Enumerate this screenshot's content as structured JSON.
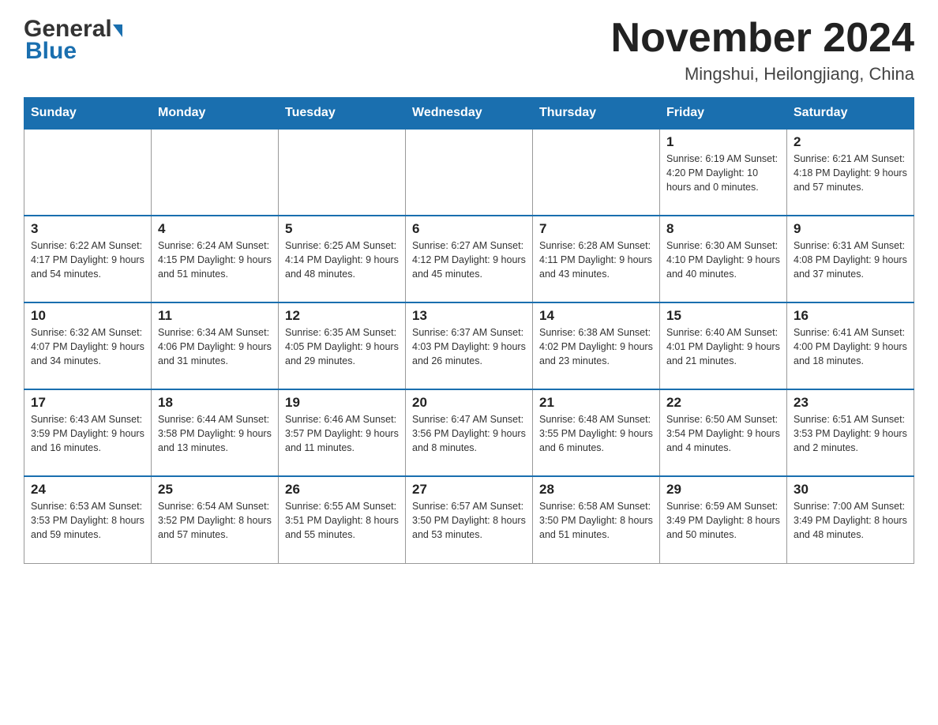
{
  "logo": {
    "general": "General",
    "blue": "Blue"
  },
  "title": "November 2024",
  "subtitle": "Mingshui, Heilongjiang, China",
  "days_of_week": [
    "Sunday",
    "Monday",
    "Tuesday",
    "Wednesday",
    "Thursday",
    "Friday",
    "Saturday"
  ],
  "weeks": [
    [
      {
        "day": "",
        "info": ""
      },
      {
        "day": "",
        "info": ""
      },
      {
        "day": "",
        "info": ""
      },
      {
        "day": "",
        "info": ""
      },
      {
        "day": "",
        "info": ""
      },
      {
        "day": "1",
        "info": "Sunrise: 6:19 AM\nSunset: 4:20 PM\nDaylight: 10 hours\nand 0 minutes."
      },
      {
        "day": "2",
        "info": "Sunrise: 6:21 AM\nSunset: 4:18 PM\nDaylight: 9 hours\nand 57 minutes."
      }
    ],
    [
      {
        "day": "3",
        "info": "Sunrise: 6:22 AM\nSunset: 4:17 PM\nDaylight: 9 hours\nand 54 minutes."
      },
      {
        "day": "4",
        "info": "Sunrise: 6:24 AM\nSunset: 4:15 PM\nDaylight: 9 hours\nand 51 minutes."
      },
      {
        "day": "5",
        "info": "Sunrise: 6:25 AM\nSunset: 4:14 PM\nDaylight: 9 hours\nand 48 minutes."
      },
      {
        "day": "6",
        "info": "Sunrise: 6:27 AM\nSunset: 4:12 PM\nDaylight: 9 hours\nand 45 minutes."
      },
      {
        "day": "7",
        "info": "Sunrise: 6:28 AM\nSunset: 4:11 PM\nDaylight: 9 hours\nand 43 minutes."
      },
      {
        "day": "8",
        "info": "Sunrise: 6:30 AM\nSunset: 4:10 PM\nDaylight: 9 hours\nand 40 minutes."
      },
      {
        "day": "9",
        "info": "Sunrise: 6:31 AM\nSunset: 4:08 PM\nDaylight: 9 hours\nand 37 minutes."
      }
    ],
    [
      {
        "day": "10",
        "info": "Sunrise: 6:32 AM\nSunset: 4:07 PM\nDaylight: 9 hours\nand 34 minutes."
      },
      {
        "day": "11",
        "info": "Sunrise: 6:34 AM\nSunset: 4:06 PM\nDaylight: 9 hours\nand 31 minutes."
      },
      {
        "day": "12",
        "info": "Sunrise: 6:35 AM\nSunset: 4:05 PM\nDaylight: 9 hours\nand 29 minutes."
      },
      {
        "day": "13",
        "info": "Sunrise: 6:37 AM\nSunset: 4:03 PM\nDaylight: 9 hours\nand 26 minutes."
      },
      {
        "day": "14",
        "info": "Sunrise: 6:38 AM\nSunset: 4:02 PM\nDaylight: 9 hours\nand 23 minutes."
      },
      {
        "day": "15",
        "info": "Sunrise: 6:40 AM\nSunset: 4:01 PM\nDaylight: 9 hours\nand 21 minutes."
      },
      {
        "day": "16",
        "info": "Sunrise: 6:41 AM\nSunset: 4:00 PM\nDaylight: 9 hours\nand 18 minutes."
      }
    ],
    [
      {
        "day": "17",
        "info": "Sunrise: 6:43 AM\nSunset: 3:59 PM\nDaylight: 9 hours\nand 16 minutes."
      },
      {
        "day": "18",
        "info": "Sunrise: 6:44 AM\nSunset: 3:58 PM\nDaylight: 9 hours\nand 13 minutes."
      },
      {
        "day": "19",
        "info": "Sunrise: 6:46 AM\nSunset: 3:57 PM\nDaylight: 9 hours\nand 11 minutes."
      },
      {
        "day": "20",
        "info": "Sunrise: 6:47 AM\nSunset: 3:56 PM\nDaylight: 9 hours\nand 8 minutes."
      },
      {
        "day": "21",
        "info": "Sunrise: 6:48 AM\nSunset: 3:55 PM\nDaylight: 9 hours\nand 6 minutes."
      },
      {
        "day": "22",
        "info": "Sunrise: 6:50 AM\nSunset: 3:54 PM\nDaylight: 9 hours\nand 4 minutes."
      },
      {
        "day": "23",
        "info": "Sunrise: 6:51 AM\nSunset: 3:53 PM\nDaylight: 9 hours\nand 2 minutes."
      }
    ],
    [
      {
        "day": "24",
        "info": "Sunrise: 6:53 AM\nSunset: 3:53 PM\nDaylight: 8 hours\nand 59 minutes."
      },
      {
        "day": "25",
        "info": "Sunrise: 6:54 AM\nSunset: 3:52 PM\nDaylight: 8 hours\nand 57 minutes."
      },
      {
        "day": "26",
        "info": "Sunrise: 6:55 AM\nSunset: 3:51 PM\nDaylight: 8 hours\nand 55 minutes."
      },
      {
        "day": "27",
        "info": "Sunrise: 6:57 AM\nSunset: 3:50 PM\nDaylight: 8 hours\nand 53 minutes."
      },
      {
        "day": "28",
        "info": "Sunrise: 6:58 AM\nSunset: 3:50 PM\nDaylight: 8 hours\nand 51 minutes."
      },
      {
        "day": "29",
        "info": "Sunrise: 6:59 AM\nSunset: 3:49 PM\nDaylight: 8 hours\nand 50 minutes."
      },
      {
        "day": "30",
        "info": "Sunrise: 7:00 AM\nSunset: 3:49 PM\nDaylight: 8 hours\nand 48 minutes."
      }
    ]
  ],
  "colors": {
    "header_bg": "#1a6faf",
    "header_text": "#ffffff",
    "border": "#999999",
    "text": "#222222"
  }
}
